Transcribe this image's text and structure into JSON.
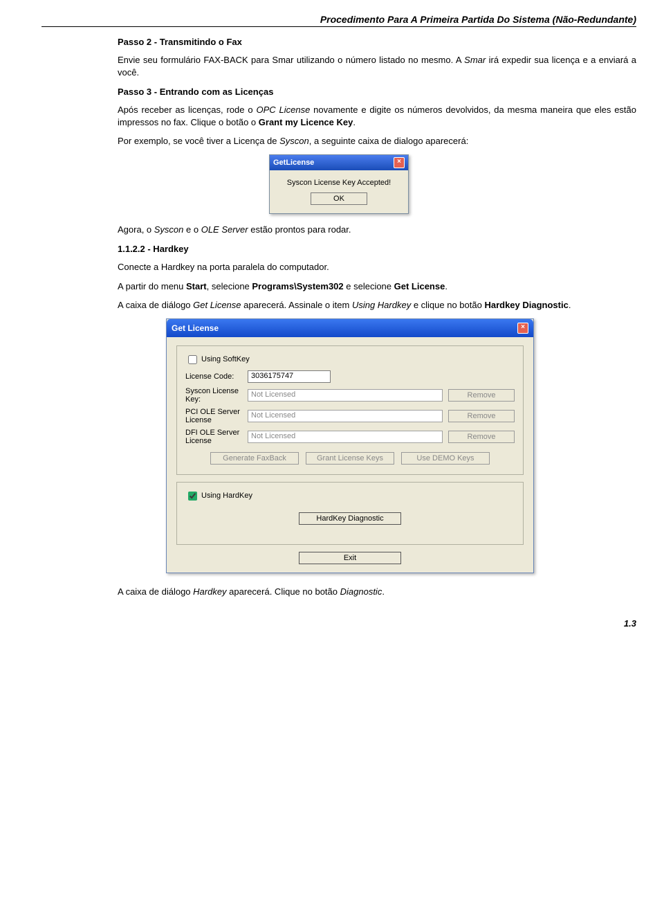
{
  "header": "Procedimento Para A Primeira Partida Do Sistema (Não-Redundante)",
  "step2_title": "Passo 2 - Transmitindo o Fax",
  "step2_p1a": "Envie seu formulário FAX-BACK para Smar utilizando o número listado no mesmo. A ",
  "step2_p1b": "Smar",
  "step2_p1c": " irá expedir sua licença e a enviará a você.",
  "step3_title": "Passo 3 - Entrando com as Licenças",
  "step3_p1a": "Após receber as licenças, rode o ",
  "step3_p1b": "OPC License",
  "step3_p1c": " novamente e digite os números devolvidos, da mesma maneira que eles estão impressos no fax. Clique o botão o ",
  "step3_p1d": "Grant my Licence Key",
  "step3_p1e": ".",
  "step3_p2a": "Por exemplo, se você tiver a Licença de ",
  "step3_p2b": "Syscon",
  "step3_p2c": ", a seguinte caixa de dialogo aparecerá:",
  "dlg1": {
    "title": "GetLicense",
    "msg": "Syscon License Key Accepted!",
    "ok": "OK"
  },
  "p_agora_a": "Agora, o ",
  "p_agora_b": "Syscon",
  "p_agora_c": " e o ",
  "p_agora_d": "OLE Server",
  "p_agora_e": " estão prontos para rodar.",
  "hk_title": "1.1.2.2 - Hardkey",
  "hk_p1": "Conecte a Hardkey na porta paralela do computador.",
  "hk_p2a": "A partir do menu ",
  "hk_p2b": "Start",
  "hk_p2c": ", selecione ",
  "hk_p2d": "Programs\\System302",
  "hk_p2e": " e selecione ",
  "hk_p2f": "Get License",
  "hk_p2g": ".",
  "hk_p3a": "A caixa de diálogo ",
  "hk_p3b": "Get License",
  "hk_p3c": " aparecerá. Assinale o item ",
  "hk_p3d": "Using Hardkey",
  "hk_p3e": " e clique no botão ",
  "hk_p3f": "Hardkey Diagnostic",
  "hk_p3g": ".",
  "dlg2": {
    "title": "Get License",
    "softkey": "Using SoftKey",
    "license_code_lbl": "License Code:",
    "license_code_val": "3036175747",
    "syscon_lbl": "Syscon License Key:",
    "pci_lbl": "PCI OLE Server License",
    "dfi_lbl": "DFI OLE Server License",
    "not_licensed": "Not Licensed",
    "remove": "Remove",
    "gen": "Generate FaxBack",
    "grant": "Grant License Keys",
    "demo": "Use DEMO Keys",
    "hardkey": "Using HardKey",
    "hkdiag": "HardKey Diagnostic",
    "exit": "Exit"
  },
  "p_final_a": "A caixa de diálogo ",
  "p_final_b": "Hardkey",
  "p_final_c": " aparecerá. Clique no botão ",
  "p_final_d": "Diagnostic",
  "p_final_e": ".",
  "page_num": "1.3"
}
